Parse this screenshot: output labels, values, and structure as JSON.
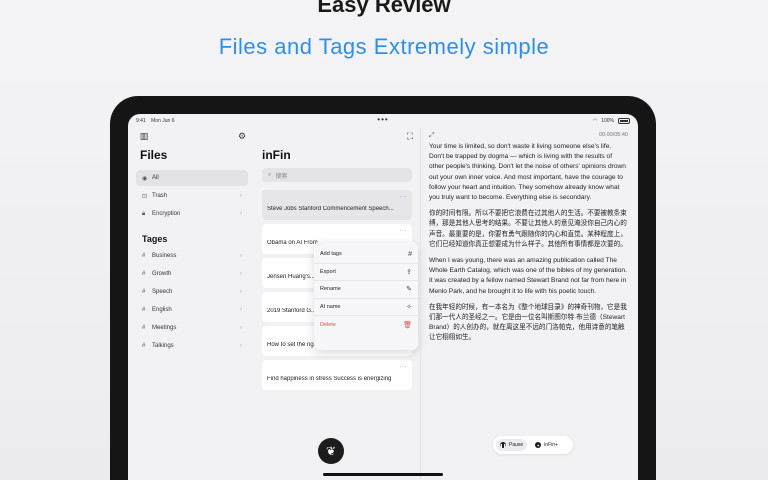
{
  "hero": {
    "title": "Easy Review",
    "subtitle": "Files and Tags Extremely simple"
  },
  "status": {
    "time": "9:41",
    "date": "Mon Jun 6",
    "battery": "100%"
  },
  "files": {
    "title": "Files",
    "items": [
      {
        "icon": "◉",
        "label": "All"
      },
      {
        "icon": "⊡",
        "label": "Trash"
      },
      {
        "icon": "🔒︎",
        "label": "Encryption"
      }
    ],
    "tags_title": "Tages",
    "tags": [
      "Business",
      "Growth",
      "Speech",
      "English",
      "Meetings",
      "Talkings"
    ]
  },
  "list": {
    "title": "inFin",
    "search_placeholder": "搜索",
    "cards": [
      {
        "title": "Steve Jobs Stanford Commencement Speech..."
      },
      {
        "title": "Obama on AI From..."
      },
      {
        "title": "Jensen Huang's..."
      },
      {
        "title": "2019 Stanford G..."
      },
      {
        "title": "How to set the right goals and stay motivated"
      },
      {
        "title": "Find happiness in stress Success is energizing"
      }
    ]
  },
  "context_menu": [
    {
      "label": "Add tags",
      "icon": "#"
    },
    {
      "label": "Export",
      "icon": "⇪"
    },
    {
      "label": "Rename",
      "icon": "✎"
    },
    {
      "label": "AI name",
      "icon": "✧"
    },
    {
      "label": "Delete",
      "icon": "🗑︎"
    }
  ],
  "reader": {
    "timer": "00:00/05:40",
    "paragraphs": [
      "Your time is limited, so don't waste it living someone else's life. Don't be trapped by dogma — which is living with the results of other people's thinking. Don't let the noise of others' opinions drown out your own inner voice. And most important, have the courage to follow your heart and intuition. They somehow already know what you truly want to become. Everything else is secondary.",
      "你的时间有限。所以不要把它浪费在过其他人的生活。不要被教条束缚，那是其他人思考的结果。不要让其他人的意见淹没你自己内心的声音。最重要的是，你要有勇气跟随你的内心和直觉。某种程度上，它们已经知道你真正想要成为什么样子。其他所有事情都是次要的。",
      "When I was young, there was an amazing publication called The Whole Earth Catalog, which was one of the bibles of my generation. It was created by a fellow named Stewart Brand not far from here in Menlo Park, and he brought it to life with his poetic touch.",
      "在我年轻的时候，有一本名为《整个地球目录》的神奇刊物，它是我们那一代人的圣经之一。它是由一位名叫斯图尔特·布兰德（Stewart Brand）的人创办的，就在离这里不远的门洛帕克，他用诗意的笔触让它栩栩如生。"
    ],
    "pause_label": "Pause",
    "infin_label": "inFin+"
  }
}
